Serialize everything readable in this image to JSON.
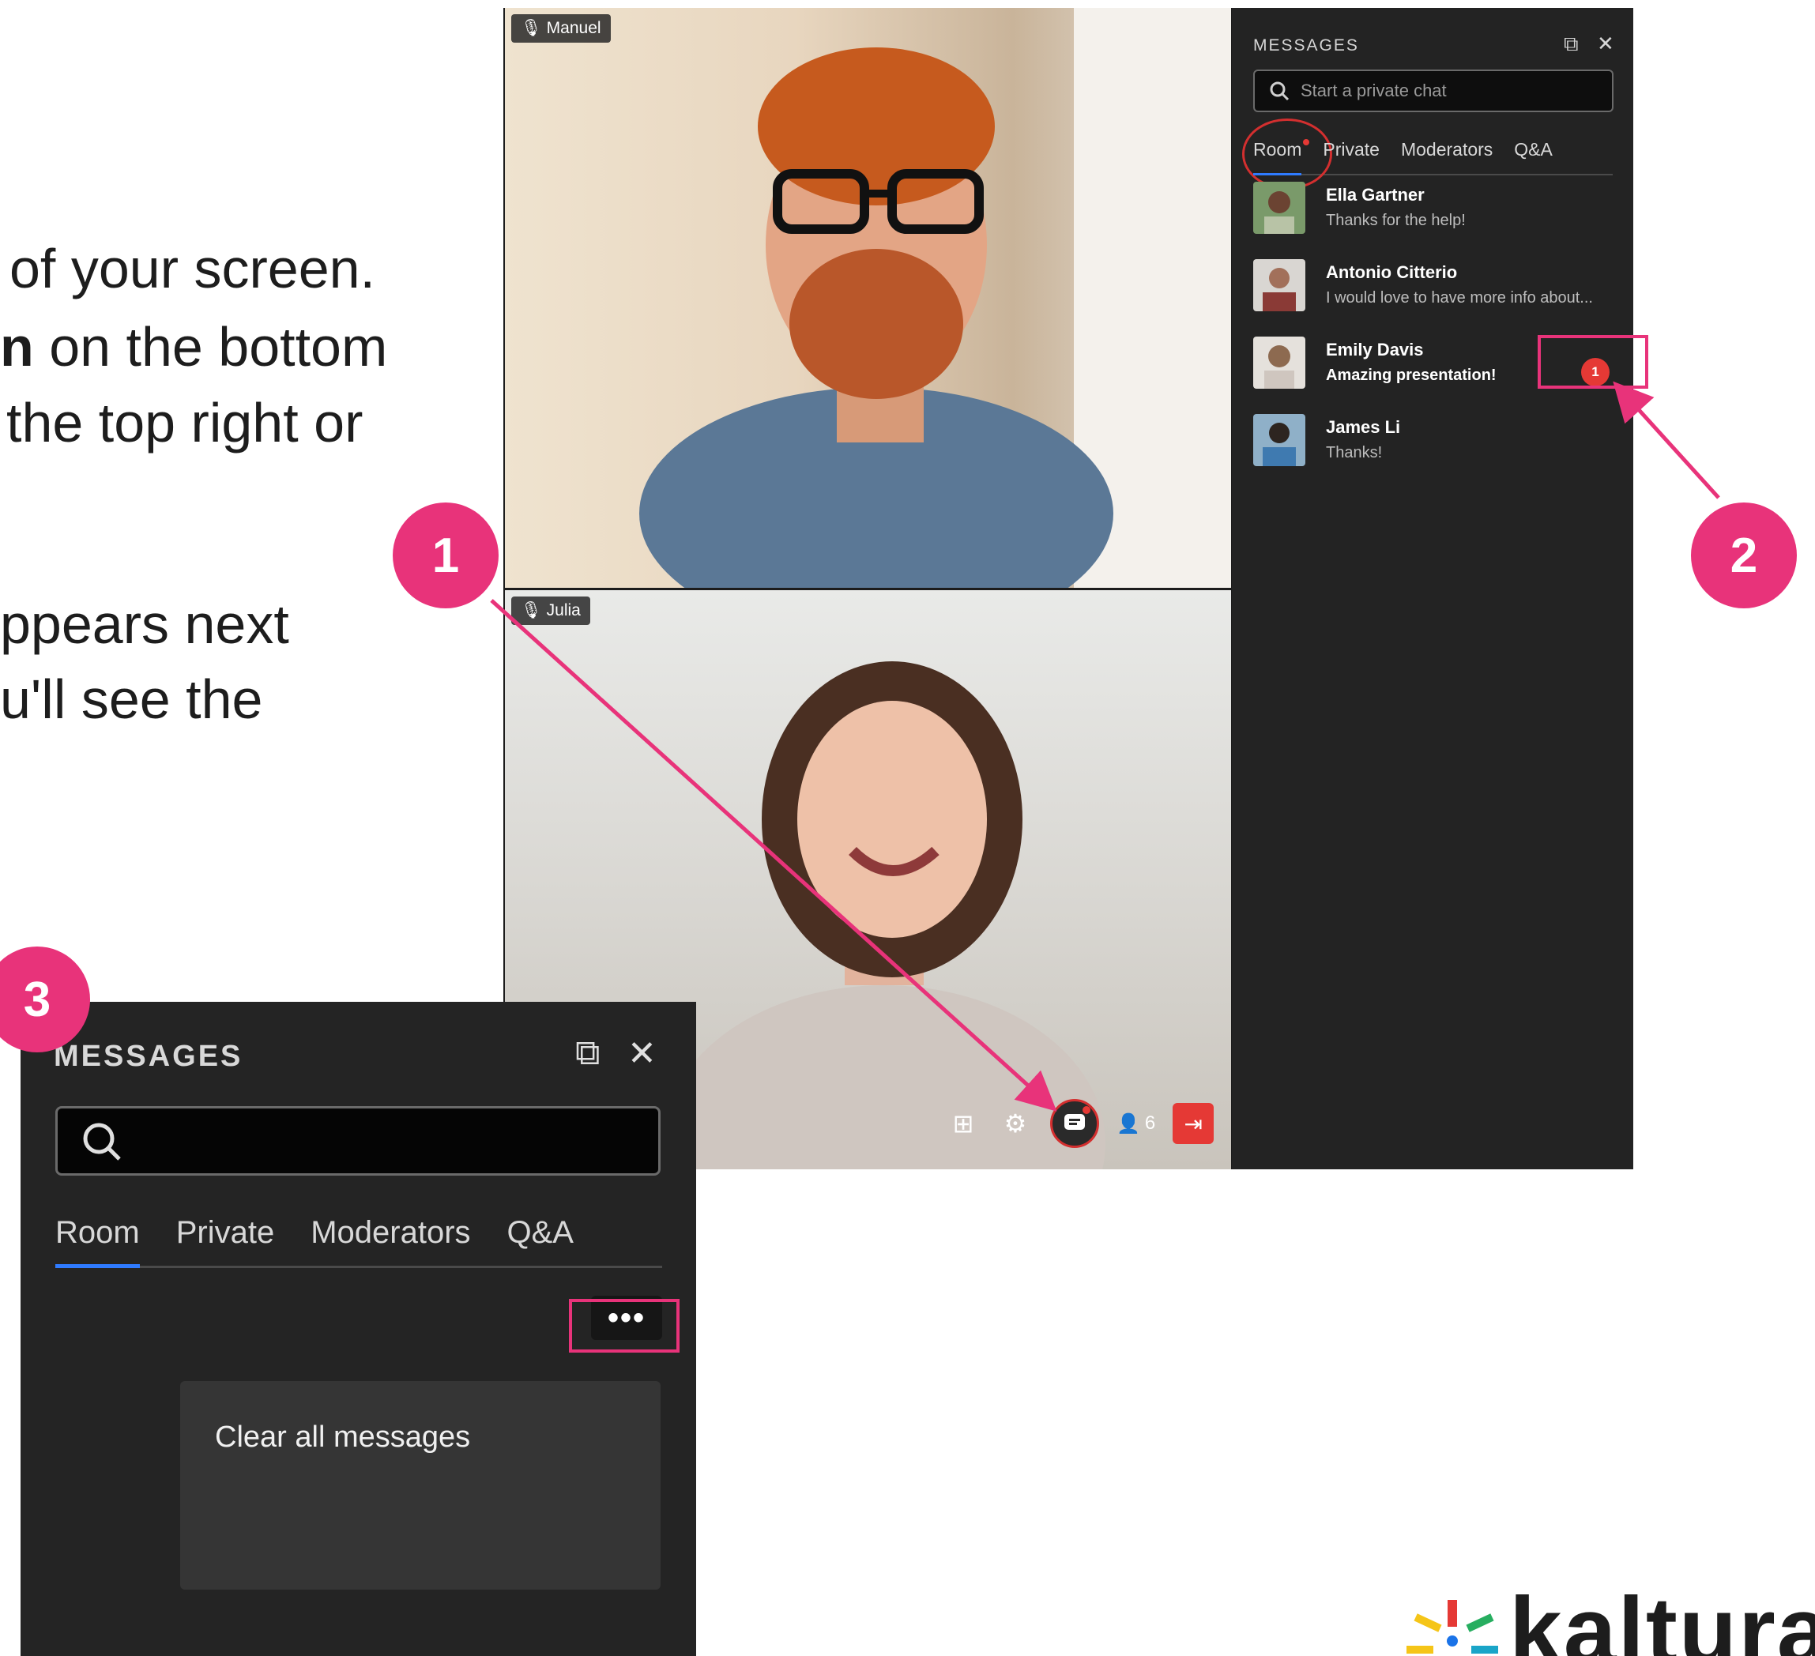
{
  "instructions": {
    "line1": "of your screen.",
    "line2_bold": "n",
    "line2_rest": " on the bottom",
    "line3": " the top right or",
    "line4": "ppears next",
    "line5": "u'll see the"
  },
  "meeting": {
    "participants": [
      {
        "name": "Manuel",
        "mic_icon": "muted-mic-icon"
      },
      {
        "name": "Julia",
        "mic_icon": "muted-mic-icon"
      }
    ],
    "toolbar": {
      "layout_icon": "grid-icon",
      "settings_icon": "gear-icon",
      "chat_icon": "chat-icon",
      "people_count": "6",
      "leave_icon": "leave-icon"
    }
  },
  "messages_panel": {
    "title": "MESSAGES",
    "search_placeholder": "Start a private chat",
    "tabs": [
      "Room",
      "Private",
      "Moderators",
      "Q&A"
    ],
    "active_tab": "Room",
    "chats": [
      {
        "name": "Ella Gartner",
        "message": "Thanks for the help!",
        "unread": false
      },
      {
        "name": "Antonio Citterio",
        "message": "I would love to have more info about...",
        "unread": false
      },
      {
        "name": "Emily Davis",
        "message": "Amazing presentation!",
        "unread": true,
        "unread_count": "1"
      },
      {
        "name": "James Li",
        "message": "Thanks!",
        "unread": false
      }
    ]
  },
  "zoom_panel": {
    "title": "MESSAGES",
    "tabs": [
      "Room",
      "Private",
      "Moderators",
      "Q&A"
    ],
    "more_label": "•••",
    "menu_item": "Clear all messages"
  },
  "callouts": [
    "1",
    "2",
    "3"
  ],
  "logo": {
    "text": "kaltura"
  },
  "colors": {
    "accent": "#e8337a",
    "alert": "#e53935",
    "tab_underline": "#2f7bff",
    "panel_bg": "#232323"
  }
}
